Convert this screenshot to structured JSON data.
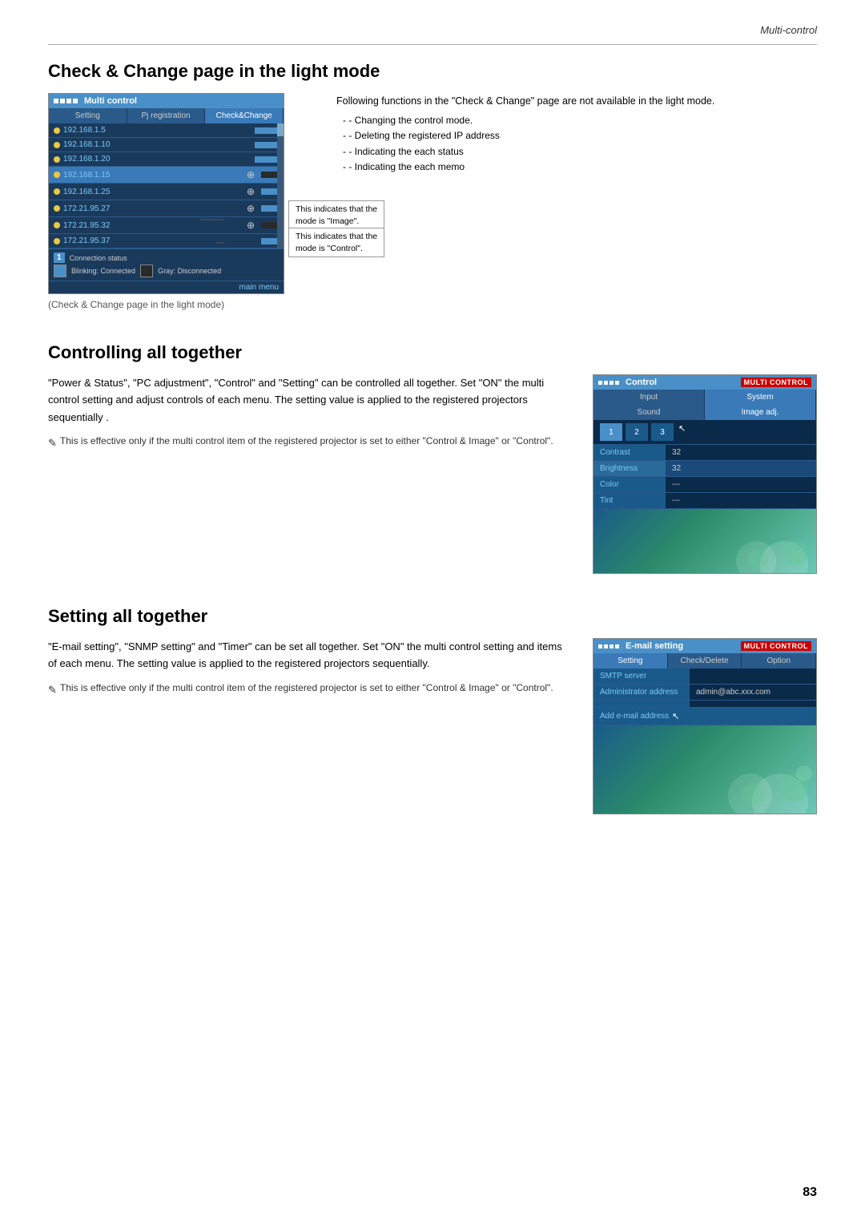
{
  "page": {
    "top_label": "Multi-control",
    "page_number": "83"
  },
  "section1": {
    "heading": "Check & Change page in the light mode",
    "caption": "(Check & Change page in the light mode)",
    "right_text": "Following functions in the \"Check & Change\" page are not available in the light mode.",
    "bullets": [
      "- Changing the control mode.",
      "- Deleting the registered IP address",
      "- Indicating the each status",
      "- Indicating the each memo"
    ],
    "callout1_line1": "This indicates that the",
    "callout1_line2": "mode is \"Image\".",
    "callout2_line1": "This indicates that the",
    "callout2_line2": "mode is \"Control\".",
    "screenshot": {
      "title": "Multi control",
      "tab_setting": "Setting",
      "tab_pj": "Pj registration",
      "tab_check": "Check&Change",
      "items": [
        {
          "ip": "192.168.1.5",
          "dot": "yellow",
          "selected": false
        },
        {
          "ip": "192.168.1.10",
          "dot": "yellow",
          "selected": false
        },
        {
          "ip": "192.168.1.20",
          "dot": "yellow",
          "selected": false
        },
        {
          "ip": "192.168.1.15",
          "dot": "yellow",
          "selected": true,
          "icon": "⊕"
        },
        {
          "ip": "192.168.1.25",
          "dot": "yellow",
          "selected": false,
          "icon": "⊕"
        },
        {
          "ip": "172.21.95.27",
          "dot": "yellow",
          "selected": false,
          "icon": "⊕"
        },
        {
          "ip": "172.21.95.32",
          "dot": "yellow",
          "selected": false,
          "icon": "⊕"
        },
        {
          "ip": "172.21.95.37",
          "dot": "yellow",
          "selected": false
        }
      ],
      "status_label": "Connection status",
      "status_blinking": "Blinking: Connected",
      "status_gray": "Gray: Disconnected",
      "main_menu": "main menu"
    }
  },
  "section2": {
    "heading": "Controlling all together",
    "para1": "\"Power & Status\", \"PC adjustment\", \"Control\" and \"Setting\" can be controlled all together. Set \"ON\" the multi control setting and adjust controls of each menu. The setting value is applied to the registered projectors sequentially .",
    "note": "This is effective only if the multi control item of the registered projector is set to either \"Control & Image\" or \"Control\".",
    "screenshot": {
      "title": "Control",
      "badge": "MULTI CONTROL",
      "tab_input": "Input",
      "tab_system": "System",
      "tab_sound": "Sound",
      "tab_imageadj": "Image adj.",
      "num_buttons": [
        "1",
        "2",
        "3"
      ],
      "rows": [
        {
          "label": "Contrast",
          "value": "32"
        },
        {
          "label": "Brightness",
          "value": "32"
        },
        {
          "label": "Color",
          "value": "---"
        },
        {
          "label": "Tint",
          "value": "---"
        }
      ]
    }
  },
  "section3": {
    "heading": "Setting all together",
    "para1": "\"E-mail setting\", \"SNMP setting\" and \"Timer\" can be set all together. Set \"ON\" the multi control setting and items of each menu. The setting value is applied to the registered projectors sequentially.",
    "note": "This is effective only if the multi control item of the registered projector is set to either \"Control & Image\" or \"Control\".",
    "screenshot": {
      "title": "E-mail setting",
      "badge": "MULTI CONTROL",
      "tab_setting": "Setting",
      "tab_check": "Check/Delete",
      "tab_option": "Option",
      "rows": [
        {
          "label": "SMTP server",
          "value": ""
        },
        {
          "label": "Administrator address",
          "value": "admin@abc.xxx.com"
        },
        {
          "label": "Add e-mail address",
          "value": ""
        }
      ]
    }
  }
}
